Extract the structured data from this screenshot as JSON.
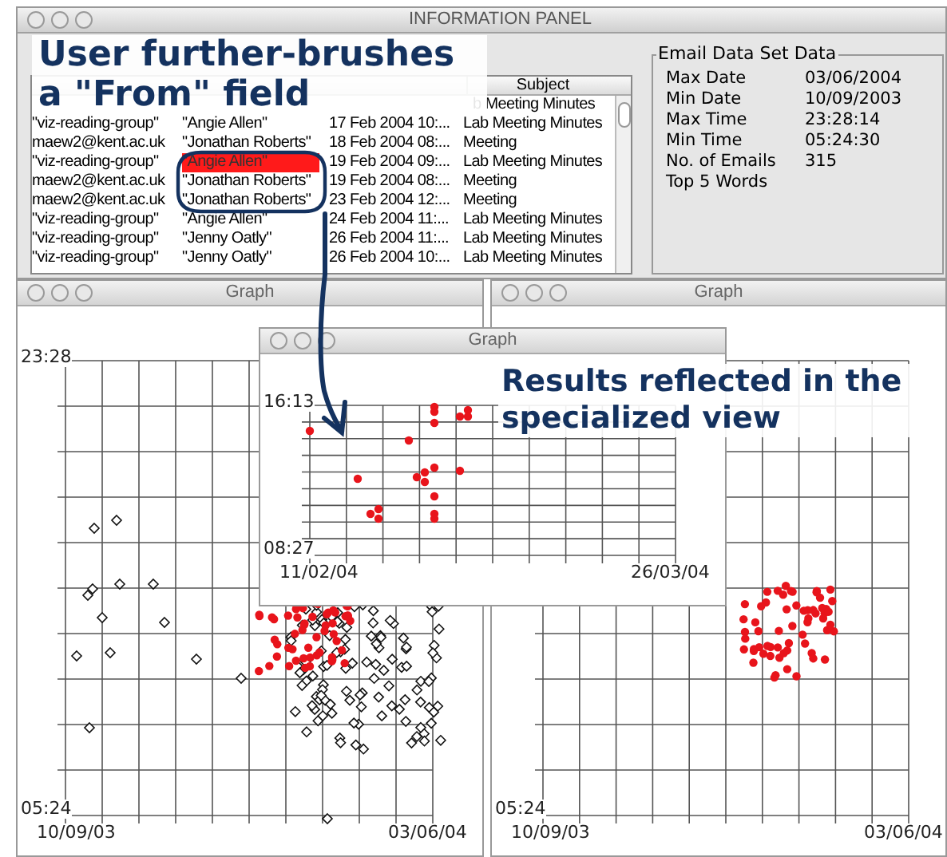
{
  "info_panel": {
    "title": "INFORMATION PANEL",
    "table": {
      "subject_header": "Subject",
      "rows": [
        {
          "kind": "partial",
          "subject": "b Meeting Minutes"
        },
        {
          "kind": "full",
          "from": "\"viz-reading-group\"",
          "name": "\"Angie Allen\"",
          "date": "17 Feb 2004 10:...",
          "subject": "Lab Meeting Minutes",
          "selected": false
        },
        {
          "kind": "full",
          "from": "maew2@kent.ac.uk",
          "name": "\"Jonathan Roberts\"",
          "date": "18 Feb 2004 08:...",
          "subject": "Meeting",
          "selected": false
        },
        {
          "kind": "full",
          "from": "\"viz-reading-group\"",
          "name": "\"Angie Allen\"",
          "date": "19 Feb 2004 09:...",
          "subject": "Lab Meeting Minutes",
          "selected": true
        },
        {
          "kind": "full",
          "from": "maew2@kent.ac.uk",
          "name": "\"Jonathan Roberts\"",
          "date": "19 Feb 2004 08:...",
          "subject": "Meeting",
          "selected": false
        },
        {
          "kind": "full",
          "from": "maew2@kent.ac.uk",
          "name": "\"Jonathan Roberts\"",
          "date": "23 Feb 2004 12:...",
          "subject": "Meeting",
          "selected": false
        },
        {
          "kind": "full",
          "from": "\"viz-reading-group\"",
          "name": "\"Angie Allen\"",
          "date": "24 Feb 2004 11:...",
          "subject": "Lab Meeting Minutes",
          "selected": false
        },
        {
          "kind": "full",
          "from": "\"viz-reading-group\"",
          "name": "\"Jenny Oatly\"",
          "date": "26 Feb 2004 11:...",
          "subject": "Lab Meeting Minutes",
          "selected": false
        },
        {
          "kind": "full",
          "from": "\"viz-reading-group\"",
          "name": "\"Jenny Oatly\"",
          "date": "26 Feb 2004 10:...",
          "subject": "Lab Meeting Minutes",
          "selected": false
        }
      ]
    },
    "stats": {
      "title": "Email Data Set Data",
      "items": [
        {
          "label": "Max Date",
          "value": "03/06/2004"
        },
        {
          "label": "Min Date",
          "value": "10/09/2003"
        },
        {
          "label": "Max Time",
          "value": "23:28:14"
        },
        {
          "label": "Min Time",
          "value": "05:24:30"
        },
        {
          "label": "No. of Emails",
          "value": "315"
        },
        {
          "label": "Top 5 Words"
        }
      ]
    }
  },
  "graphs": [
    {
      "title": "Graph",
      "kind": "mixed",
      "y_top": "23:28",
      "y_bottom": "05:24",
      "x_start": "10/09/03",
      "x_end": "03/06/04"
    },
    {
      "title": "Graph",
      "kind": "brushed",
      "y_bottom": "05:24",
      "x_start": "10/09/03",
      "x_end": "03/06/04"
    },
    {
      "title": "Graph",
      "kind": "zoomed",
      "y_top": "16:13",
      "y_bottom": "08:27",
      "x_start": "11/02/04",
      "x_end": "26/03/04"
    }
  ],
  "callouts": [
    {
      "text": "User further-brushes a \"From\" field"
    },
    {
      "text": "Results reflected in the specialized view"
    }
  ]
}
